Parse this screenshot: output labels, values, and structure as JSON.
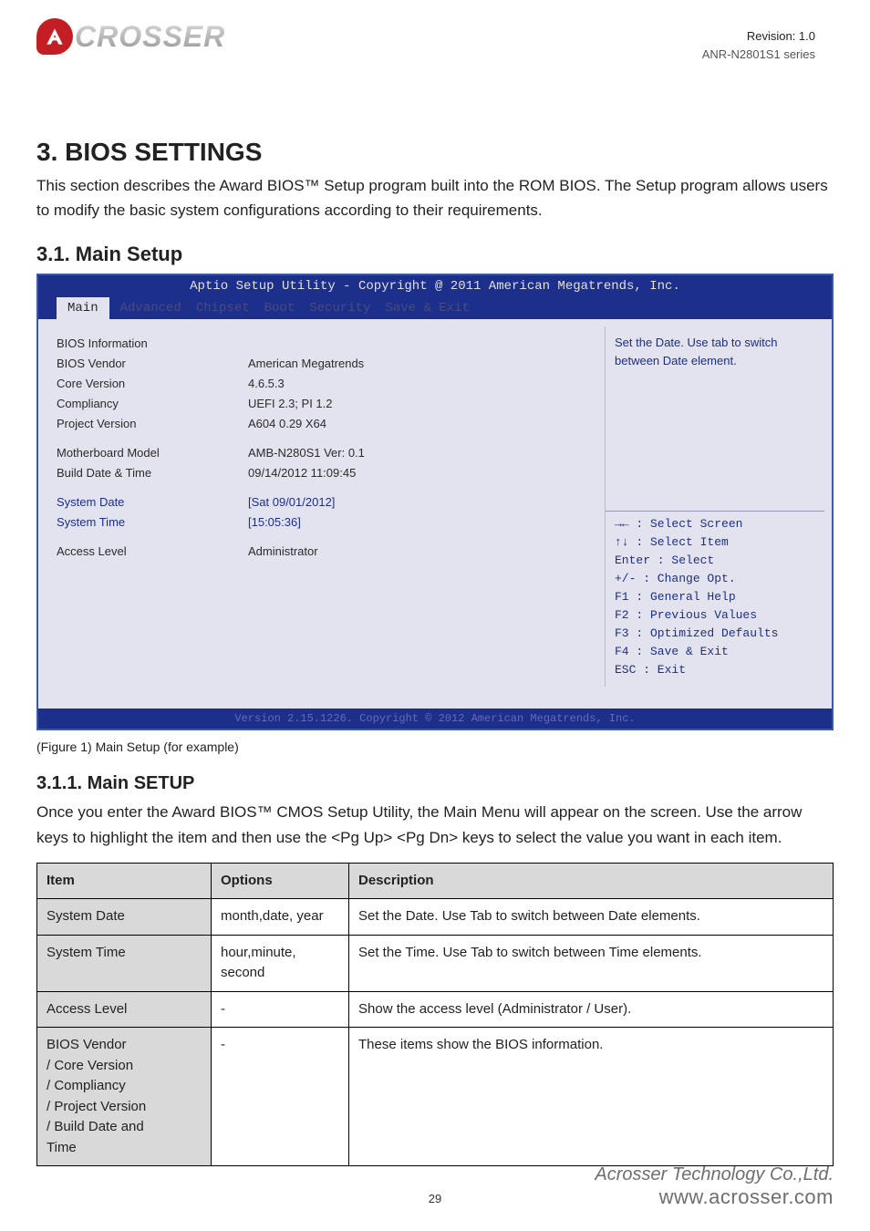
{
  "header": {
    "revision": "Revision: 1.0",
    "model": "ANR-N2801S1 series"
  },
  "sections": {
    "h1": "3. BIOS SETTINGS",
    "h2": "3.1. Main Setup",
    "intro": "This section describes the Award BIOS™ Setup program built into the ROM BIOS. The Setup program allows users to modify the basic system configurations according to their requirements.",
    "fig_caption": "(Figure 1) Main Setup (for example)",
    "h3": "3.1.1. Main SETUP",
    "p2": "Once you enter the Award BIOS™ CMOS Setup Utility, the Main Menu will appear on the screen. Use the arrow keys to highlight the item and then use the <Pg Up> <Pg Dn> keys to select the value you want in each item."
  },
  "bios": {
    "title": "Aptio Setup Utility - Copyright @ 2011 American Megatrends, Inc.",
    "tabs": [
      "Main",
      "Advanced",
      "Chipset",
      "Boot",
      "Security",
      "Save & Exit"
    ],
    "active_tab": "Main",
    "rows": {
      "h_info": "BIOS Information",
      "vendor_l": "BIOS Vendor",
      "vendor_v": "American Megatrends",
      "core_l": "Core Version",
      "core_v": "4.6.5.3",
      "comp_l": "Compliancy",
      "comp_v": "UEFI 2.3; PI 1.2",
      "proj_l": "Project Version",
      "proj_v": "A604 0.29 X64",
      "mb_l": "Motherboard Model",
      "mb_v": "AMB-N280S1 Ver: 0.1",
      "build_l": "Build Date & Time",
      "build_v": "09/14/2012  11:09:45",
      "date_l": "System Date",
      "date_v": "[Sat 09/01/2012]",
      "time_l": "System Time",
      "time_v": "[15:05:36]",
      "acc_l": "Access Level",
      "acc_v": "Administrator"
    },
    "help_top": "Set the Date. Use tab to switch between Date element.",
    "keys": [
      "→← : Select Screen",
      "↑↓ : Select Item",
      "Enter : Select",
      "+/- : Change Opt.",
      "F1 : General Help",
      "F2 : Previous Values",
      "F3 : Optimized Defaults",
      "F4 : Save & Exit",
      "ESC : Exit"
    ],
    "footer": "Version 2.15.1226. Copyright © 2012 American Megatrends, Inc."
  },
  "table": {
    "head": [
      "Item",
      "Options",
      "Description"
    ],
    "rows": [
      {
        "item": "System Date",
        "opt": "month,date, year",
        "desc": "Set the Date. Use Tab to switch between Date elements."
      },
      {
        "item": "System Time",
        "opt": "hour,minute, second",
        "desc": "Set the Time. Use Tab to switch between Time elements."
      },
      {
        "item": "Access Level",
        "opt": "-",
        "desc": "Show the access level (Administrator / User)."
      }
    ],
    "multi": {
      "item": "BIOS Vendor\n/ Core Version\n/ Compliancy\n/ Project Version\n/ Build Date and\nTime",
      "opt": "-",
      "desc": "These items show the BIOS information."
    }
  },
  "footer": {
    "company": "Acrosser Technology Co.,Ltd.",
    "url": "www.acrosser.com",
    "page": "29"
  }
}
